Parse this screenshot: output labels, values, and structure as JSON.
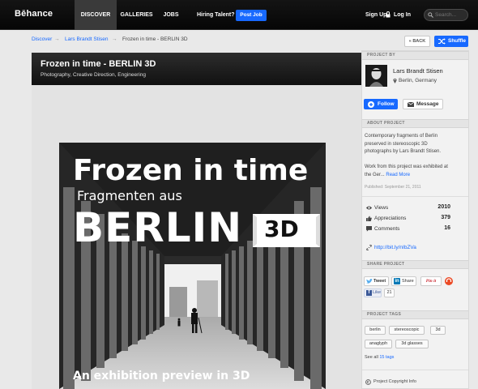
{
  "nav": {
    "brand": "Bēhance",
    "tabs": [
      {
        "label": "DISCOVER"
      },
      {
        "label": "GALLERIES"
      },
      {
        "label": "JOBS"
      }
    ],
    "hiring": "Hiring Talent?",
    "post_job": "Post Job",
    "sign_up": "Sign Up",
    "log_in": "Log In",
    "search_placeholder": "Search..."
  },
  "breadcrumb": {
    "items": [
      "Discover",
      "Lars Brandt Stisen",
      "Frozen in time - BERLIN 3D"
    ],
    "separator": "→"
  },
  "actions": {
    "back": "« BACK",
    "shuffle": "Shuffle"
  },
  "project": {
    "title": "Frozen in time - BERLIN 3D",
    "fields": "Photography, Creative Direction, Engineering"
  },
  "poster": {
    "line1": "Frozen in time",
    "line2": "Fragmenten aus",
    "line3": "BERLIN",
    "badge": "3D",
    "caption": "An exhibition preview in 3D"
  },
  "sidebar": {
    "project_by": "PROJECT BY",
    "owner_name": "Lars Brandt Stisen",
    "owner_location": "Berlin, Germany",
    "follow": "Follow",
    "message": "Message",
    "about_head": "ABOUT PROJECT",
    "about_lines": [
      "Contemporary fragments of Berlin",
      "preserved in stereoscopic 3D",
      "photographs by Lars Brandt Stisen."
    ],
    "work_lines": [
      "Work from this project was exhibited at",
      "the Ger..."
    ],
    "read_more": "Read More",
    "published": "Published: September 21, 2011",
    "stats": [
      {
        "label": "Views",
        "value": "2010",
        "icon": "eye-icon"
      },
      {
        "label": "Appreciations",
        "value": "379",
        "icon": "thumbs-up-icon"
      },
      {
        "label": "Comments",
        "value": "16",
        "icon": "comment-icon"
      }
    ],
    "short_url": "http://bit.ly/nIbZVa",
    "share_head": "SHARE PROJECT",
    "tweet": "Tweet",
    "share": "Share",
    "pinit": "Pin it",
    "fb_like": "Like",
    "fb_count": "21",
    "tags_head": "PROJECT TAGS",
    "tags": [
      "berlin",
      "stereoscopic",
      "3d",
      "anaglyph",
      "3d glasses"
    ],
    "see_all_prefix": "See all",
    "see_all_link": "15 tags",
    "copyright": "Project Copyright Info"
  },
  "colors": {
    "accent": "#1769ff",
    "nav_bg": "#0b0b0b",
    "title_bar": "#222222"
  }
}
